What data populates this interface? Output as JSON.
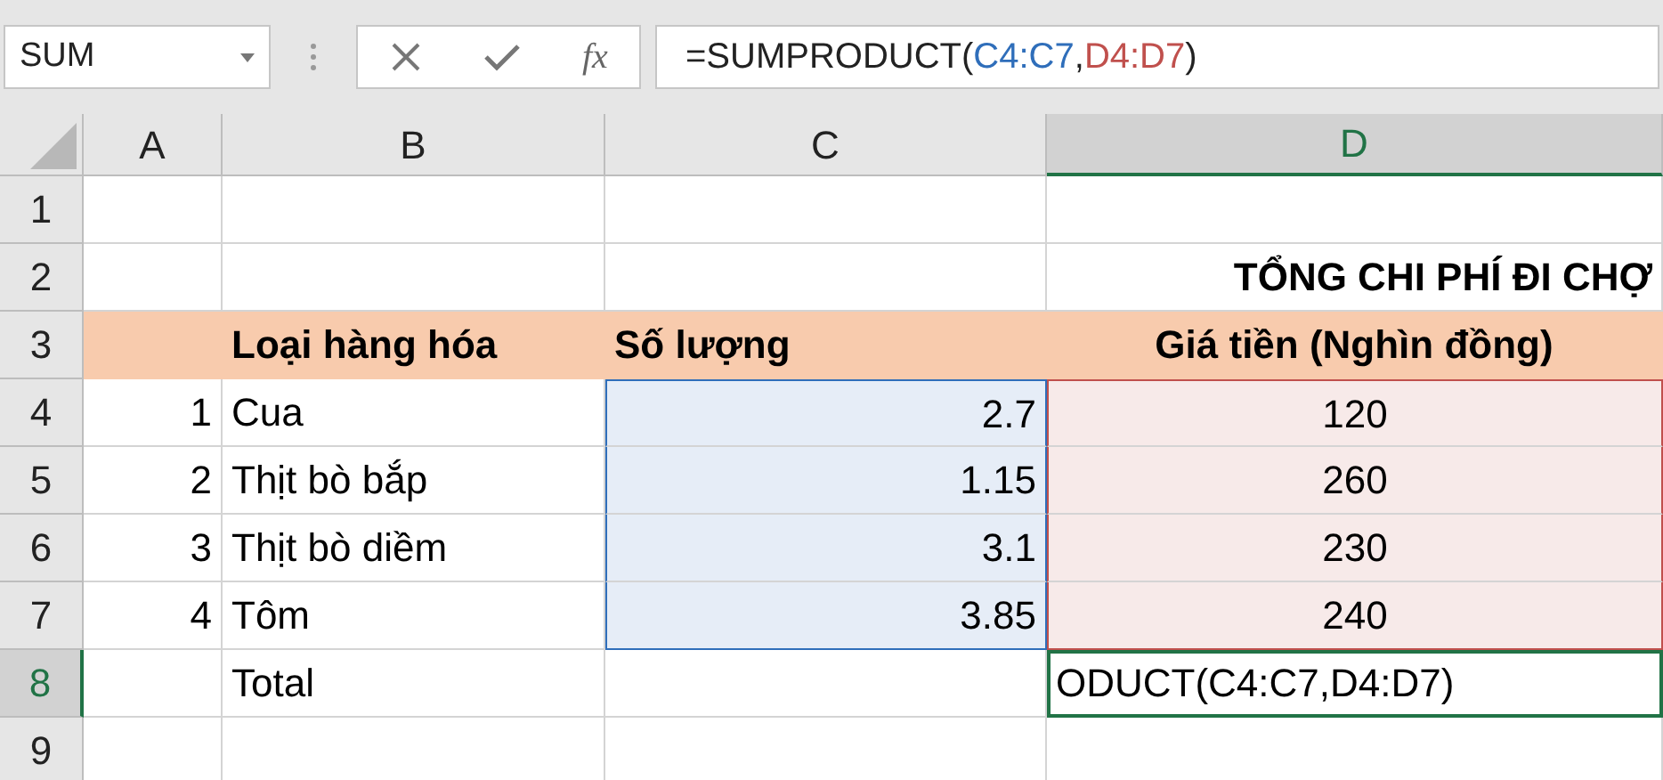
{
  "name_box": "SUM",
  "formula_buttons": [
    {
      "kind": "cancel"
    },
    {
      "kind": "enter"
    },
    {
      "kind": "function",
      "text": "fx"
    }
  ],
  "formula": [
    {
      "text": "=SUMPRODUCT("
    },
    {
      "text": "C4:C7",
      "color": "#2f6eba"
    },
    {
      "text": ","
    },
    {
      "text": "D4:D7",
      "color": "#c0504d"
    },
    {
      "text": ")"
    }
  ],
  "columns": [
    {
      "label": "A",
      "selected": false
    },
    {
      "label": "B",
      "selected": false
    },
    {
      "label": "C",
      "selected": false
    },
    {
      "label": "D",
      "selected": true
    }
  ],
  "rows": [
    {
      "header": "1",
      "selected": false,
      "kind": "blank",
      "cells": []
    },
    {
      "header": "2",
      "selected": false,
      "kind": "title",
      "cells": [
        {
          "text": ""
        },
        {
          "text": ""
        },
        {
          "text": ""
        },
        {
          "text": "TỔNG CHI PHÍ ĐI CHỢ"
        }
      ]
    },
    {
      "header": "3",
      "selected": false,
      "kind": "header",
      "cells": [
        {
          "text": ""
        },
        {
          "text": "Loại hàng hóa"
        },
        {
          "text": "Số lượng"
        },
        {
          "text": "Giá tiền (Nghìn đồng)"
        }
      ]
    },
    {
      "header": "4",
      "selected": false,
      "kind": "data",
      "cells": [
        {
          "text": "1"
        },
        {
          "text": "Cua"
        },
        {
          "text": "2.7",
          "color": "#2f6eba"
        },
        {
          "text": "120",
          "color": "#c0504d"
        }
      ]
    },
    {
      "header": "5",
      "selected": false,
      "kind": "data",
      "cells": [
        {
          "text": "2"
        },
        {
          "text": "Thịt bò bắp"
        },
        {
          "text": "1.15",
          "color": "#2f6eba"
        },
        {
          "text": "260",
          "color": "#c0504d"
        }
      ]
    },
    {
      "header": "6",
      "selected": false,
      "kind": "data",
      "cells": [
        {
          "text": "3"
        },
        {
          "text": "Thịt bò diềm"
        },
        {
          "text": "3.1",
          "color": "#2f6eba"
        },
        {
          "text": "230",
          "color": "#c0504d"
        }
      ]
    },
    {
      "header": "7",
      "selected": false,
      "kind": "data",
      "cells": [
        {
          "text": "4"
        },
        {
          "text": "Tôm"
        },
        {
          "text": "3.85",
          "color": "#2f6eba"
        },
        {
          "text": "240",
          "color": "#c0504d"
        }
      ]
    },
    {
      "header": "8",
      "selected": true,
      "kind": "total",
      "cells": [
        {
          "text": ""
        },
        {
          "text": "Total"
        },
        {
          "text": ""
        },
        {
          "text": "ODUCT(C4:C7,D4:D7)",
          "active": true
        }
      ]
    },
    {
      "header": "9",
      "selected": false,
      "kind": "blank",
      "cells": []
    }
  ]
}
